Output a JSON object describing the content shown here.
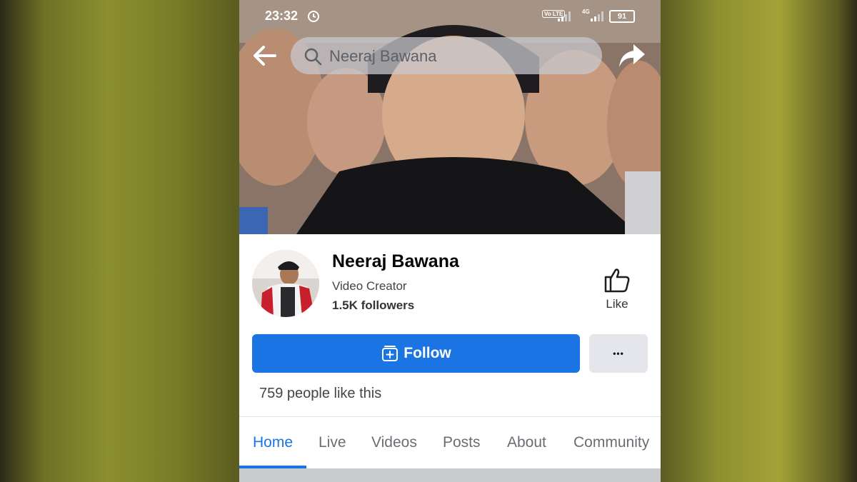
{
  "status_bar": {
    "time": "23:32",
    "volte": "Vo LTE",
    "network": "4G",
    "battery": "91"
  },
  "search": {
    "query": "Neeraj Bawana"
  },
  "profile": {
    "name": "Neeraj Bawana",
    "category": "Video Creator",
    "followers": "1.5K followers",
    "like_label": "Like",
    "follow_label": "Follow",
    "more_label": "•••",
    "likes_count": "759 people like this"
  },
  "tabs": [
    {
      "label": "Home",
      "active": true
    },
    {
      "label": "Live",
      "active": false
    },
    {
      "label": "Videos",
      "active": false
    },
    {
      "label": "Posts",
      "active": false
    },
    {
      "label": "About",
      "active": false
    },
    {
      "label": "Community",
      "active": false
    }
  ],
  "colors": {
    "accent": "#1b74e4",
    "secondary_button": "#e4e6eb"
  },
  "icons": [
    "back-arrow-icon",
    "search-icon",
    "share-icon",
    "thumbs-up-icon",
    "follow-page-icon",
    "alarm-icon",
    "signal-icon",
    "battery-icon"
  ]
}
